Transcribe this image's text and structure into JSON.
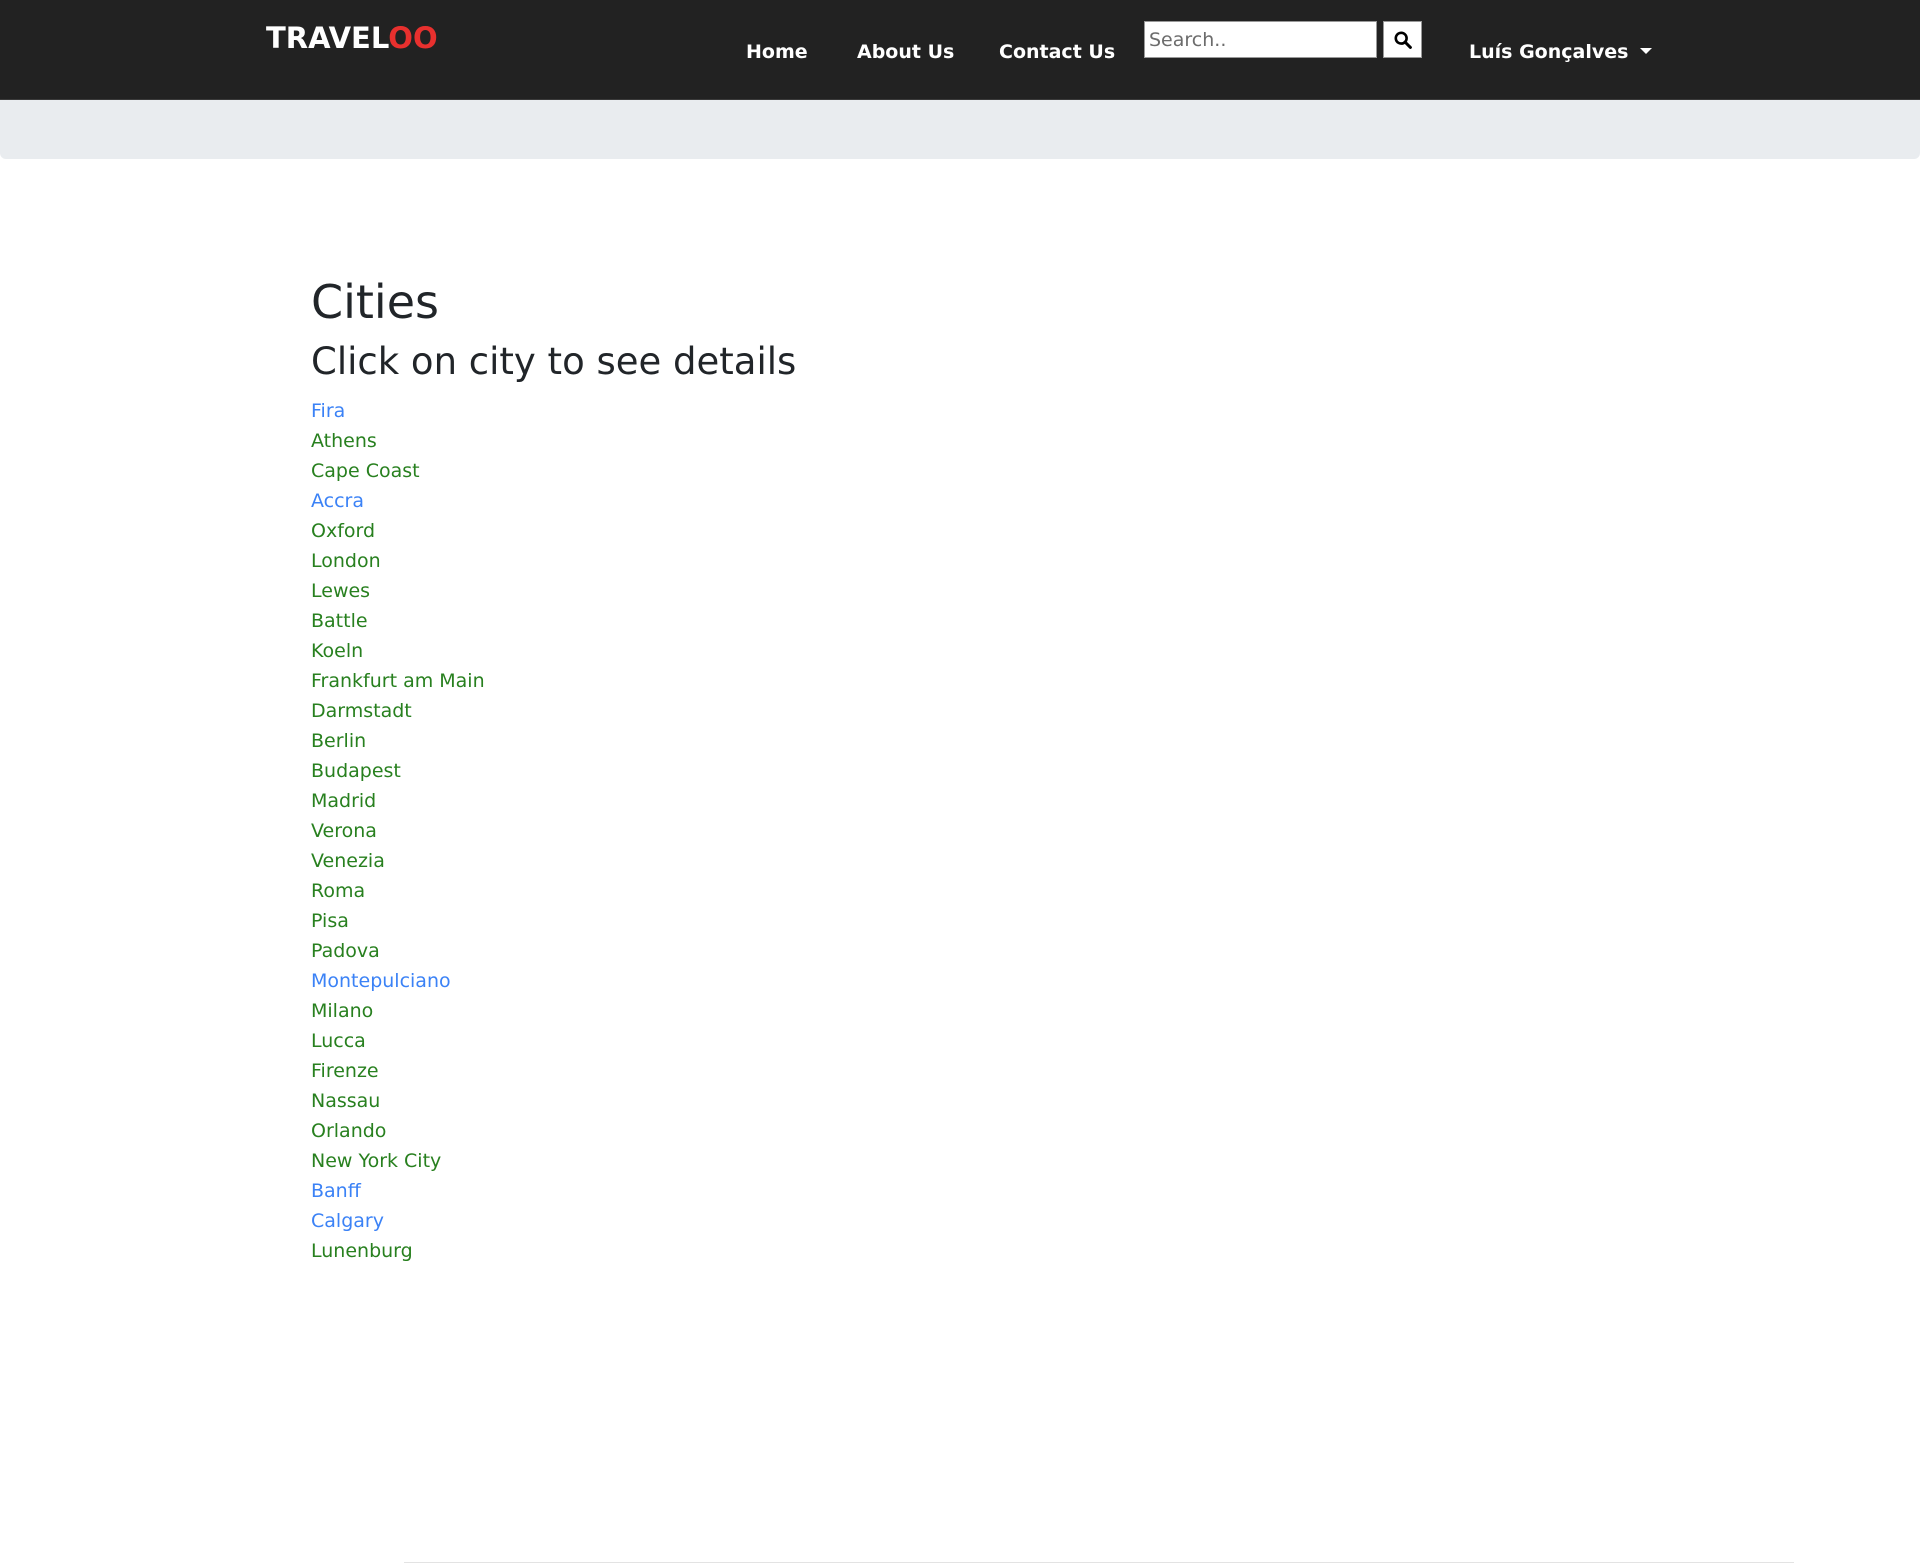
{
  "navbar": {
    "brand_main": "TRAVEL",
    "brand_accent": "OO",
    "links": {
      "home": "Home",
      "about": "About Us",
      "contact": "Contact Us"
    },
    "search_placeholder": "Search..",
    "search_icon": "search-icon",
    "user_name": "Luís Gonçalves"
  },
  "main": {
    "title": "Cities",
    "subtitle": "Click on city to see details"
  },
  "colors": {
    "navbar_bg": "#222222",
    "brand_accent": "#e8302e",
    "band_bg": "#e9ecef",
    "city_default": "#28801f",
    "city_highlight": "#3b82f6"
  },
  "cities": [
    {
      "name": "Fira",
      "highlighted": true
    },
    {
      "name": "Athens",
      "highlighted": false
    },
    {
      "name": "Cape Coast",
      "highlighted": false
    },
    {
      "name": "Accra",
      "highlighted": true
    },
    {
      "name": "Oxford",
      "highlighted": false
    },
    {
      "name": "London",
      "highlighted": false
    },
    {
      "name": "Lewes",
      "highlighted": false
    },
    {
      "name": "Battle",
      "highlighted": false
    },
    {
      "name": "Koeln",
      "highlighted": false
    },
    {
      "name": "Frankfurt am Main",
      "highlighted": false
    },
    {
      "name": "Darmstadt",
      "highlighted": false
    },
    {
      "name": "Berlin",
      "highlighted": false
    },
    {
      "name": "Budapest",
      "highlighted": false
    },
    {
      "name": "Madrid",
      "highlighted": false
    },
    {
      "name": "Verona",
      "highlighted": false
    },
    {
      "name": "Venezia",
      "highlighted": false
    },
    {
      "name": "Roma",
      "highlighted": false
    },
    {
      "name": "Pisa",
      "highlighted": false
    },
    {
      "name": "Padova",
      "highlighted": false
    },
    {
      "name": "Montepulciano",
      "highlighted": true
    },
    {
      "name": "Milano",
      "highlighted": false
    },
    {
      "name": "Lucca",
      "highlighted": false
    },
    {
      "name": "Firenze",
      "highlighted": false
    },
    {
      "name": "Nassau",
      "highlighted": false
    },
    {
      "name": "Orlando",
      "highlighted": false
    },
    {
      "name": "New York City",
      "highlighted": false
    },
    {
      "name": "Banff",
      "highlighted": true
    },
    {
      "name": "Calgary",
      "highlighted": true
    },
    {
      "name": "Lunenburg",
      "highlighted": false
    }
  ]
}
